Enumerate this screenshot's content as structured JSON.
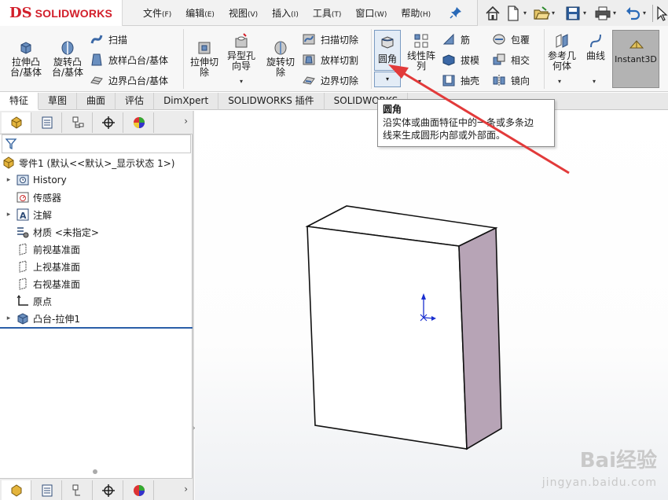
{
  "app": {
    "logo_mark": "DS",
    "logo_name": "SOLIDWORKS"
  },
  "menu": [
    {
      "label": "文件",
      "key": "(F)"
    },
    {
      "label": "编辑",
      "key": "(E)"
    },
    {
      "label": "视图",
      "key": "(V)"
    },
    {
      "label": "插入",
      "key": "(I)"
    },
    {
      "label": "工具",
      "key": "(T)"
    },
    {
      "label": "窗口",
      "key": "(W)"
    },
    {
      "label": "帮助",
      "key": "(H)"
    }
  ],
  "ribbon": {
    "extrude_boss": "拉伸凸台/基体",
    "revolve_boss": "旋转凸台/基体",
    "sweep": "扫描",
    "loft_boss": "放样凸台/基体",
    "boundary_boss": "边界凸台/基体",
    "extrude_cut": "拉伸切除",
    "hole_wizard": "异型孔向导",
    "revolve_cut": "旋转切除",
    "sweep_cut": "扫描切除",
    "loft_cut": "放样切割",
    "boundary_cut": "边界切除",
    "fillet": "圆角",
    "linear_pattern": "线性阵列",
    "rib": "筋",
    "draft": "拔模",
    "shell": "抽壳",
    "wrap": "包覆",
    "intersect": "相交",
    "mirror": "镜向",
    "ref_geometry": "参考几何体",
    "curves": "曲线",
    "instant3d": "Instant3D"
  },
  "tabs": [
    "特征",
    "草图",
    "曲面",
    "评估",
    "DimXpert",
    "SOLIDWORKS 插件",
    "SOLIDWORKS"
  ],
  "tooltip": {
    "title": "圆角",
    "line1": "沿实体或曲面特征中的一条或多条边",
    "line2": "线来生成圆形内部或外部面。"
  },
  "tree": {
    "part": "零件1 (默认<<默认>_显示状态 1>)",
    "history": "History",
    "sensors": "传感器",
    "annotations": "注解",
    "material": "材质 <未指定>",
    "front_plane": "前视基准面",
    "top_plane": "上视基准面",
    "right_plane": "右视基准面",
    "origin": "原点",
    "boss_extrude": "凸台-拉伸1"
  },
  "watermark": {
    "line1": "Bai经验",
    "line2": "jingyan.baidu.com"
  },
  "colors": {
    "logo_red": "#d21e2a",
    "annotation_arrow": "#e23a3a",
    "box_side": "#b7a4b6",
    "tree_separator": "#2a5ea8"
  }
}
